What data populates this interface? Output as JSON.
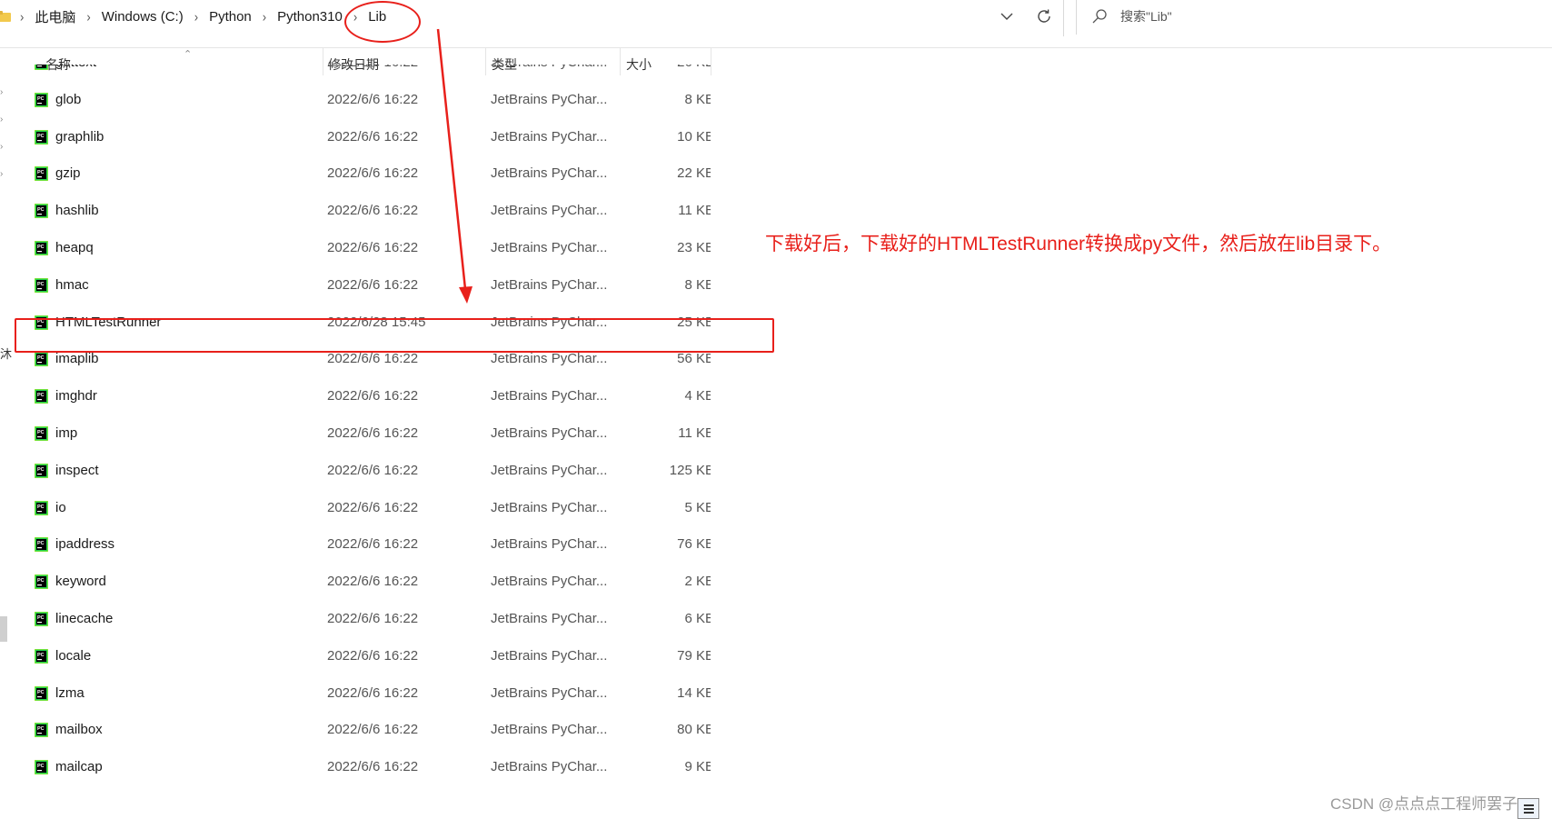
{
  "address_bar": {
    "breadcrumb": [
      "此电脑",
      "Windows (C:)",
      "Python",
      "Python310",
      "Lib"
    ],
    "search_placeholder": "搜索\"Lib\""
  },
  "columns": {
    "name": "名称",
    "modified": "修改日期",
    "type": "类型",
    "size": "大小"
  },
  "files": [
    {
      "name": "gettext",
      "modified": "2022/6/6 16:22",
      "type": "JetBrains PyChar...",
      "size": "26 KB"
    },
    {
      "name": "glob",
      "modified": "2022/6/6 16:22",
      "type": "JetBrains PyChar...",
      "size": "8 KB"
    },
    {
      "name": "graphlib",
      "modified": "2022/6/6 16:22",
      "type": "JetBrains PyChar...",
      "size": "10 KB"
    },
    {
      "name": "gzip",
      "modified": "2022/6/6 16:22",
      "type": "JetBrains PyChar...",
      "size": "22 KB"
    },
    {
      "name": "hashlib",
      "modified": "2022/6/6 16:22",
      "type": "JetBrains PyChar...",
      "size": "11 KB"
    },
    {
      "name": "heapq",
      "modified": "2022/6/6 16:22",
      "type": "JetBrains PyChar...",
      "size": "23 KB"
    },
    {
      "name": "hmac",
      "modified": "2022/6/6 16:22",
      "type": "JetBrains PyChar...",
      "size": "8 KB"
    },
    {
      "name": "HTMLTestRunner",
      "modified": "2022/6/28 15:45",
      "type": "JetBrains PyChar...",
      "size": "25 KB"
    },
    {
      "name": "imaplib",
      "modified": "2022/6/6 16:22",
      "type": "JetBrains PyChar...",
      "size": "56 KB"
    },
    {
      "name": "imghdr",
      "modified": "2022/6/6 16:22",
      "type": "JetBrains PyChar...",
      "size": "4 KB"
    },
    {
      "name": "imp",
      "modified": "2022/6/6 16:22",
      "type": "JetBrains PyChar...",
      "size": "11 KB"
    },
    {
      "name": "inspect",
      "modified": "2022/6/6 16:22",
      "type": "JetBrains PyChar...",
      "size": "125 KB"
    },
    {
      "name": "io",
      "modified": "2022/6/6 16:22",
      "type": "JetBrains PyChar...",
      "size": "5 KB"
    },
    {
      "name": "ipaddress",
      "modified": "2022/6/6 16:22",
      "type": "JetBrains PyChar...",
      "size": "76 KB"
    },
    {
      "name": "keyword",
      "modified": "2022/6/6 16:22",
      "type": "JetBrains PyChar...",
      "size": "2 KB"
    },
    {
      "name": "linecache",
      "modified": "2022/6/6 16:22",
      "type": "JetBrains PyChar...",
      "size": "6 KB"
    },
    {
      "name": "locale",
      "modified": "2022/6/6 16:22",
      "type": "JetBrains PyChar...",
      "size": "79 KB"
    },
    {
      "name": "lzma",
      "modified": "2022/6/6 16:22",
      "type": "JetBrains PyChar...",
      "size": "14 KB"
    },
    {
      "name": "mailbox",
      "modified": "2022/6/6 16:22",
      "type": "JetBrains PyChar...",
      "size": "80 KB"
    },
    {
      "name": "mailcap",
      "modified": "2022/6/6 16:22",
      "type": "JetBrains PyChar...",
      "size": "9 KB"
    }
  ],
  "annotation": {
    "text": "下载好后，下载好的HTMLTestRunner转换成py文件，然后放在lib目录下。",
    "color": "#e8201b"
  },
  "nav_glyph": "沐",
  "watermark": "CSDN @点点点工程师罢子",
  "icons": {
    "file_icon": "pycharm-file-icon",
    "search": "search-icon",
    "refresh": "refresh-icon",
    "dropdown": "chevron-down-icon"
  }
}
